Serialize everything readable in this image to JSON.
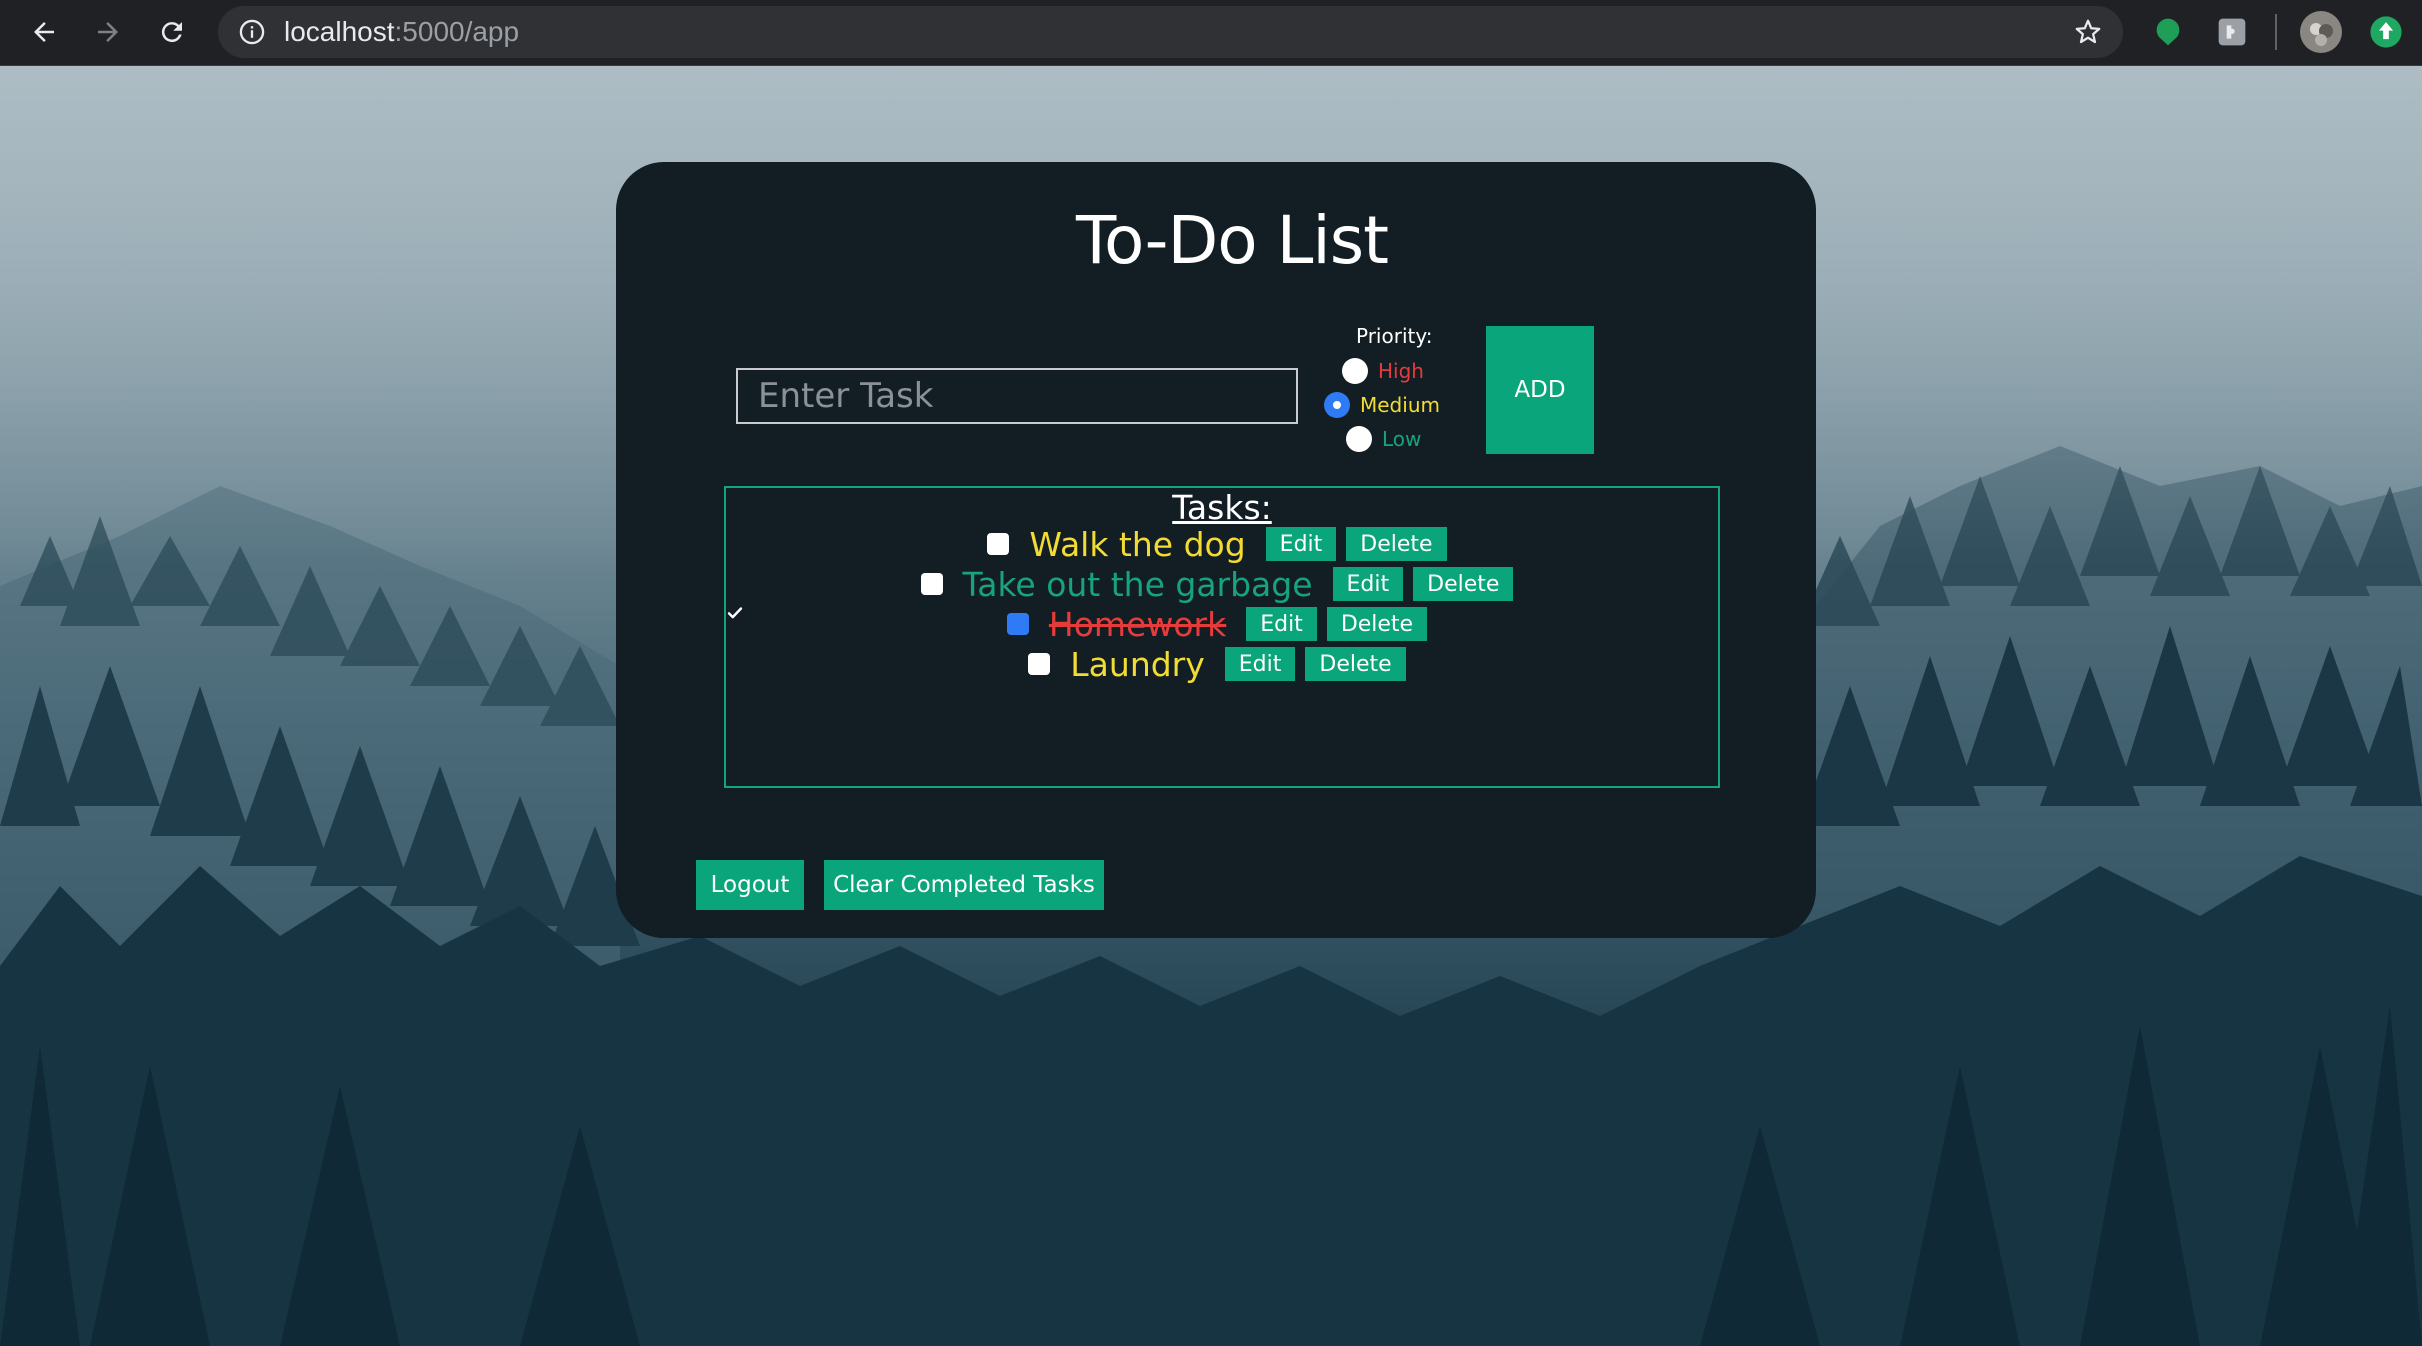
{
  "browser": {
    "url_host": "localhost",
    "url_path": ":5000/app"
  },
  "app": {
    "title": "To-Do List",
    "task_input_placeholder": "Enter Task",
    "priority_label": "Priority:",
    "priorities": [
      {
        "label": "High",
        "color": "#e53b3b",
        "checked": false
      },
      {
        "label": "Medium",
        "color": "#f2dc33",
        "checked": true
      },
      {
        "label": "Low",
        "color": "#17a37b",
        "checked": false
      }
    ],
    "add_label": "ADD",
    "tasks_heading": "Tasks:",
    "tasks": [
      {
        "text": "Walk the dog",
        "priority": "Medium",
        "color": "#f2dc33",
        "completed": false
      },
      {
        "text": "Take out the garbage",
        "priority": "Low",
        "color": "#17a37b",
        "completed": false
      },
      {
        "text": "Homework",
        "priority": "High",
        "color": "#e53b3b",
        "completed": true
      },
      {
        "text": "Laundry",
        "priority": "Medium",
        "color": "#f2dc33",
        "completed": false
      }
    ],
    "edit_label": "Edit",
    "delete_label": "Delete",
    "logout_label": "Logout",
    "clear_label": "Clear Completed Tasks"
  },
  "colors": {
    "accent": "#0aa57a",
    "card_bg": "#131e24"
  }
}
